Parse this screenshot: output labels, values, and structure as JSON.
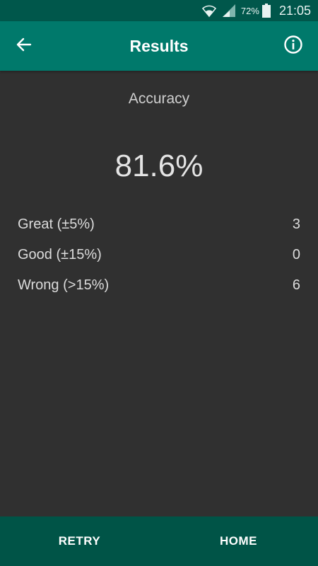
{
  "status_bar": {
    "battery_percent": "72%",
    "time": "21:05"
  },
  "app_bar": {
    "title": "Results",
    "back_icon": "arrow-left-icon",
    "info_icon": "info-circle-icon"
  },
  "accuracy": {
    "label": "Accuracy",
    "value": "81.6%"
  },
  "results": [
    {
      "label": "Great (±5%)",
      "count": "3"
    },
    {
      "label": "Good (±15%)",
      "count": "0"
    },
    {
      "label": "Wrong (>15%)",
      "count": "6"
    }
  ],
  "bottom_bar": {
    "retry_label": "RETRY",
    "home_label": "HOME"
  },
  "colors": {
    "status_bar": "#00574b",
    "app_bar": "#00796b",
    "background": "#303030",
    "bottom_bar": "#005447"
  }
}
